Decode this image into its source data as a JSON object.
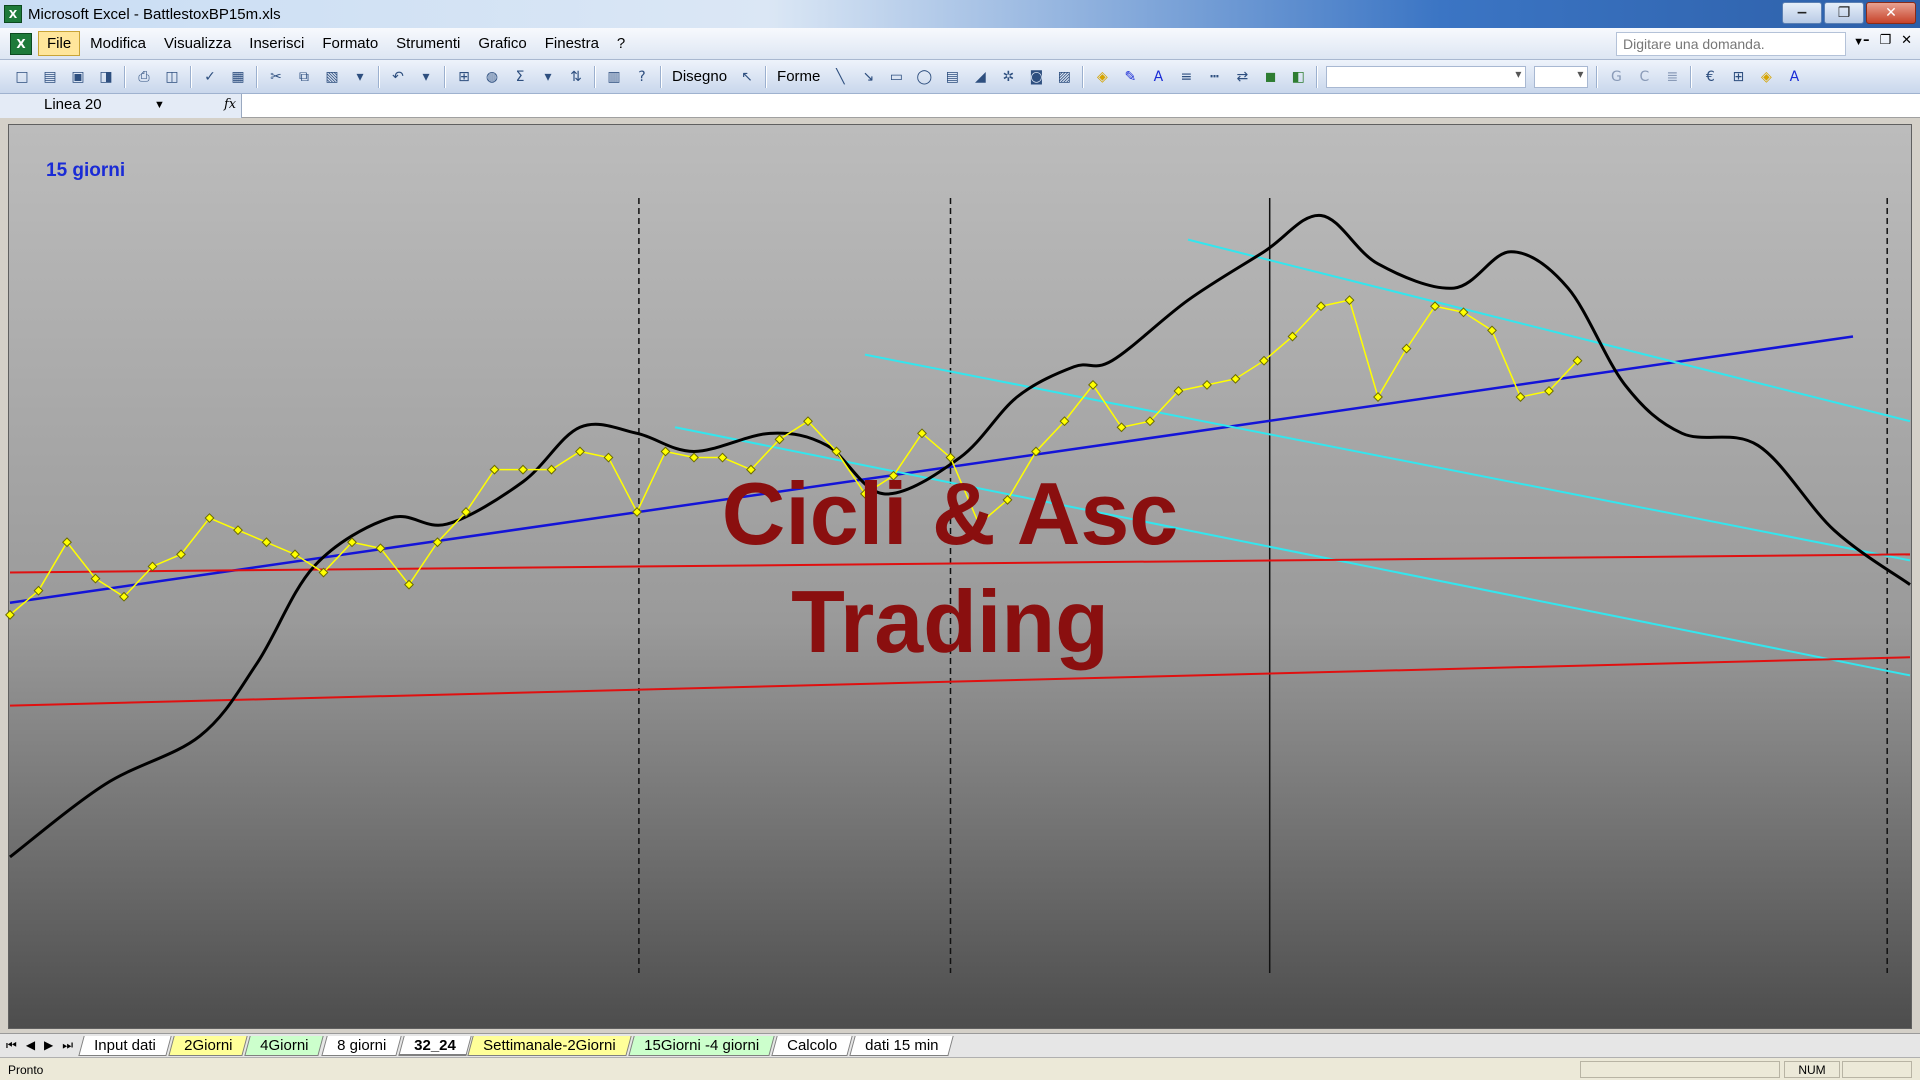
{
  "window": {
    "title": "Microsoft Excel - BattlestoxBP15m.xls",
    "app_icon": "excel-icon",
    "controls": [
      "minimize-icon",
      "restore-icon",
      "close-icon"
    ]
  },
  "menu": {
    "items": [
      "File",
      "Modifica",
      "Visualizza",
      "Inserisci",
      "Formato",
      "Strumenti",
      "Grafico",
      "Finestra",
      "?"
    ],
    "help_placeholder": "Digitare una domanda."
  },
  "toolbar": {
    "disegno_label": "Disegno",
    "forme_label": "Forme"
  },
  "formula_bar": {
    "name_box": "Linea 20",
    "fx_icon": "fx-icon"
  },
  "chart": {
    "label": "15 giorni",
    "watermark_line1": "Cicli & Asc",
    "watermark_line2": "Trading",
    "colors": {
      "price": "#ffff00",
      "price_outline": "#6b6b00",
      "cycle": "#000000",
      "trend_blue": "#1414d8",
      "channel_cyan": "#33e6ee",
      "support_red": "#e01010",
      "watermark": "#8a0f0f",
      "label": "#1a2bd6"
    }
  },
  "chart_data": {
    "type": "line",
    "title": "",
    "xlabel": "",
    "ylabel": "",
    "xlim": [
      0,
      100
    ],
    "ylim": [
      0,
      100
    ],
    "grid": false,
    "legend": "none",
    "series": [
      {
        "style": "price-markers",
        "x": [
          0,
          1.5,
          3,
          4.5,
          6,
          7.5,
          9,
          10.5,
          12,
          13.5,
          15,
          16.5,
          18,
          19.5,
          21,
          22.5,
          24,
          25.5,
          27,
          28.5,
          30,
          31.5,
          33,
          34.5,
          36,
          37.5,
          39,
          40.5,
          42,
          43.5,
          45,
          46.5,
          48,
          49.5,
          51,
          52.5,
          54,
          55.5,
          57,
          58.5,
          60,
          61.5,
          63,
          64.5,
          66,
          67.5,
          69,
          70.5,
          72,
          73.5,
          75,
          76.5,
          78,
          79.5,
          81,
          82.5
        ],
        "values": [
          60,
          64,
          72,
          66,
          63,
          68,
          70,
          76,
          74,
          72,
          70,
          67,
          72,
          71,
          65,
          72,
          77,
          84,
          84,
          84,
          87,
          86,
          77,
          87,
          86,
          86,
          84,
          89,
          92,
          87,
          80,
          83,
          90,
          86,
          75,
          79,
          87,
          92,
          98,
          91,
          92,
          97,
          98,
          99,
          102,
          106,
          111,
          112,
          96,
          104,
          111,
          110,
          107,
          96,
          97,
          102
        ]
      },
      {
        "style": "cycle-curve",
        "x": [
          0,
          5,
          10,
          13,
          16,
          20,
          23,
          27,
          30,
          33,
          36,
          40,
          43,
          46,
          50,
          53,
          56,
          58,
          62,
          66,
          69,
          72,
          76,
          79,
          82,
          85,
          88,
          92,
          96,
          100
        ],
        "values": [
          20,
          32,
          40,
          52,
          68,
          76,
          75,
          82,
          91,
          90,
          87,
          90,
          88,
          80,
          86,
          96,
          101,
          102,
          112,
          120,
          126,
          118,
          114,
          120,
          114,
          98,
          90,
          88,
          74,
          65
        ]
      }
    ],
    "trendlines": [
      {
        "type": "trend",
        "from": [
          0,
          62
        ],
        "to": [
          97,
          106
        ]
      },
      {
        "type": "channel",
        "from": [
          35,
          91
        ],
        "to": [
          100,
          50
        ]
      },
      {
        "type": "channel",
        "from": [
          45,
          103
        ],
        "to": [
          100,
          69
        ]
      },
      {
        "type": "channel",
        "from": [
          62,
          122
        ],
        "to": [
          100,
          92
        ]
      },
      {
        "type": "support",
        "from": [
          0,
          67
        ],
        "to": [
          100,
          70
        ]
      },
      {
        "type": "support",
        "from": [
          0,
          45
        ],
        "to": [
          100,
          53
        ]
      }
    ],
    "cycle_markers": [
      {
        "x": 33.1,
        "style": "dashed"
      },
      {
        "x": 49.5,
        "style": "dashed"
      },
      {
        "x": 66.3,
        "style": "solid"
      },
      {
        "x": 98.8,
        "style": "dashed"
      }
    ]
  },
  "sheet_tabs": [
    {
      "label": "Input dati",
      "color": "white"
    },
    {
      "label": "2Giorni",
      "color": "yellow"
    },
    {
      "label": "4Giorni",
      "color": "green"
    },
    {
      "label": "8 giorni",
      "color": "white"
    },
    {
      "label": "32_24",
      "color": "active"
    },
    {
      "label": "Settimanale-2Giorni",
      "color": "yellow"
    },
    {
      "label": "15Giorni -4 giorni",
      "color": "green"
    },
    {
      "label": "Calcolo",
      "color": "white"
    },
    {
      "label": "dati 15 min",
      "color": "white"
    }
  ],
  "status": {
    "text": "Pronto",
    "num": "NUM"
  }
}
